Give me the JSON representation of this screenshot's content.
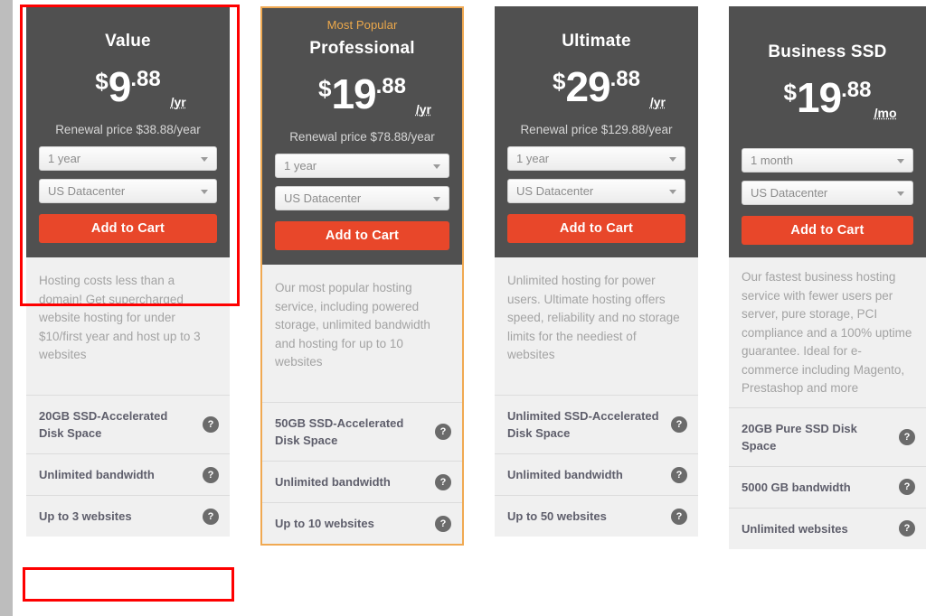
{
  "theme": {
    "header_bg": "#505050",
    "card_bg": "#f0f0f0",
    "cart_button": "#e8472a",
    "popular_accent": "#f0a952",
    "highlight": "#fe0000"
  },
  "icons": {
    "caret": "chevron-down-icon",
    "help": "question-mark-icon"
  },
  "plans": [
    {
      "badge": "",
      "name": "Value",
      "currency": "$",
      "whole": "9",
      "cents": ".88",
      "period": "/yr",
      "renewal": "Renewal price $38.88/year",
      "term": "1 year",
      "datacenter": "US Datacenter",
      "cart_label": "Add to Cart",
      "description": "Hosting costs less than a domain! Get supercharged website hosting for under $10/first year and host up to 3 websites",
      "features": [
        "20GB SSD-Accelerated Disk Space",
        "Unlimited bandwidth",
        "Up to 3 websites"
      ],
      "help_label": "?"
    },
    {
      "badge": "Most Popular",
      "name": "Professional",
      "currency": "$",
      "whole": "19",
      "cents": ".88",
      "period": "/yr",
      "renewal": "Renewal price $78.88/year",
      "term": "1 year",
      "datacenter": "US Datacenter",
      "cart_label": "Add to Cart",
      "description": "Our most popular hosting service, including powered storage, unlimited bandwidth and hosting for up to 10 websites",
      "features": [
        "50GB SSD-Accelerated Disk Space",
        "Unlimited bandwidth",
        "Up to 10 websites"
      ],
      "help_label": "?"
    },
    {
      "badge": "",
      "name": "Ultimate",
      "currency": "$",
      "whole": "29",
      "cents": ".88",
      "period": "/yr",
      "renewal": "Renewal price $129.88/year",
      "term": "1 year",
      "datacenter": "US Datacenter",
      "cart_label": "Add to Cart",
      "description": "Unlimited hosting for power users. Ultimate hosting offers speed, reliability and no storage limits for the neediest of websites",
      "features": [
        "Unlimited SSD-Accelerated Disk Space",
        "Unlimited bandwidth",
        "Up to 50 websites"
      ],
      "help_label": "?"
    },
    {
      "badge": "",
      "name": "Business SSD",
      "currency": "$",
      "whole": "19",
      "cents": ".88",
      "period": "/mo",
      "renewal": "",
      "term": "1 month",
      "datacenter": "US Datacenter",
      "cart_label": "Add to Cart",
      "description": "Our fastest business hosting service with fewer users per server, pure storage, PCI compliance and a 100% uptime guarantee. Ideal for e-commerce including Magento, Prestashop and more",
      "features": [
        "20GB Pure SSD Disk Space",
        "5000 GB bandwidth",
        "Unlimited websites"
      ],
      "help_label": "?"
    }
  ]
}
